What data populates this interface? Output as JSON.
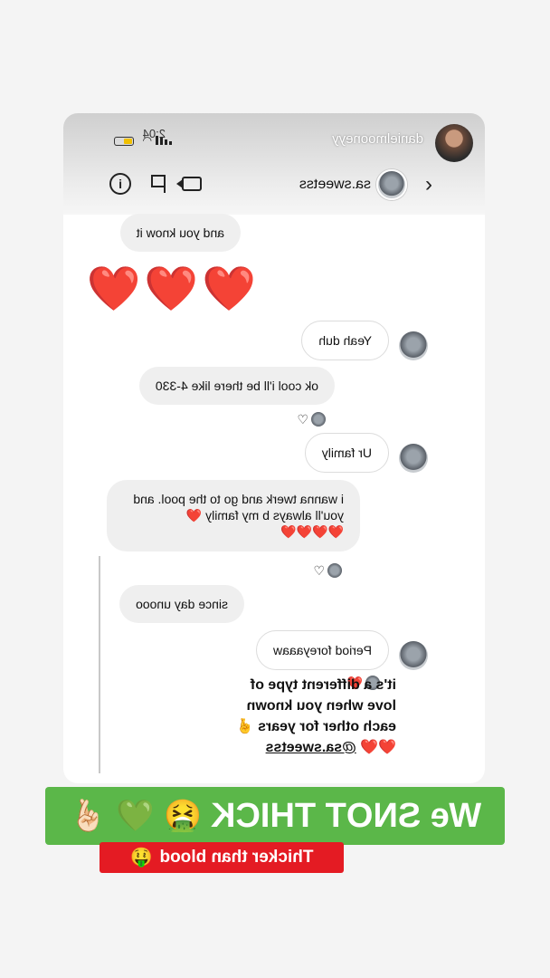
{
  "status_bar": {
    "time": "2:04",
    "username": "danielmooneyy"
  },
  "chat_header": {
    "name": "sa.sweetss",
    "icons": [
      "chevron-left-icon",
      "video-icon",
      "flag-icon",
      "info-icon"
    ]
  },
  "messages": [
    {
      "sender": "them",
      "text": "and you know it"
    },
    {
      "sender": "them",
      "text": "❤️❤️❤️"
    },
    {
      "sender": "me",
      "text": "Yeah duh"
    },
    {
      "sender": "them",
      "text": "ok cool i'll be there like 4-330",
      "reaction": "♡"
    },
    {
      "sender": "me",
      "text": "Ur family"
    },
    {
      "sender": "them",
      "text": "i wanna twerk and go to the pool. and you'll always b my family ❤️",
      "line2": "❤️❤️❤️❤️",
      "reaction": "♡"
    },
    {
      "sender": "them",
      "text": "since day unooo"
    },
    {
      "sender": "me",
      "text": "Period foreyaaaw",
      "reaction": "❤️"
    }
  ],
  "caption": {
    "line1": "it's a different type of",
    "line2": "love when you known",
    "line3": "each other for years 🤞",
    "hearts": "❤️❤️",
    "mention": "@sa.sweetss"
  },
  "sticker_main": {
    "text": "We SNOT THICK",
    "emojis": [
      "🤮",
      "💚",
      "🤞🏻"
    ]
  },
  "sticker_sub": {
    "text": "Thicker than blood",
    "emoji": "🤑"
  },
  "colors": {
    "green_sticker": "#5bb749",
    "red_sticker": "#e41b23",
    "heart": "#e0202c"
  }
}
